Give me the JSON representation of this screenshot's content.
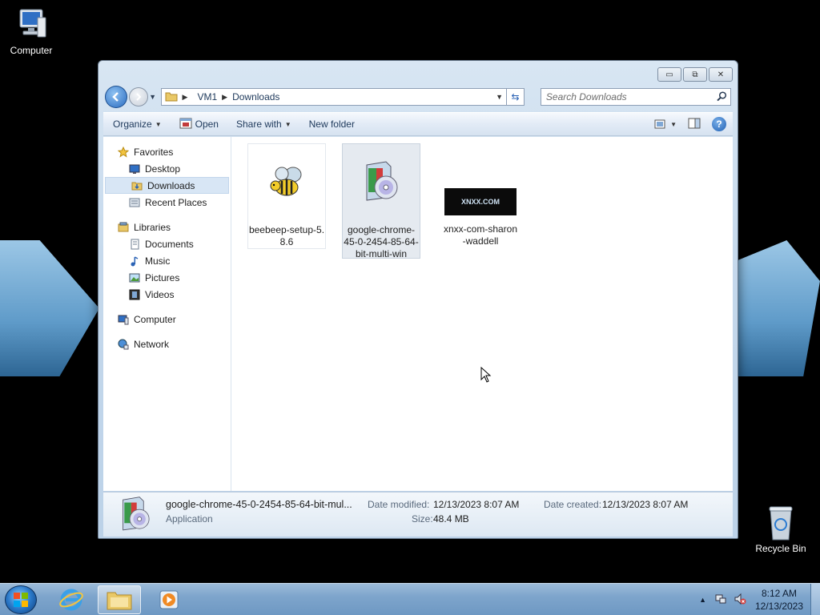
{
  "desktop": {
    "computer_label": "Computer",
    "recycle_bin_label": "Recycle Bin"
  },
  "window": {
    "caption_buttons": {
      "minimize": "▭",
      "maximize": "⧉",
      "close": "✕"
    },
    "address": {
      "segments": [
        "VM1",
        "Downloads"
      ]
    },
    "search": {
      "placeholder": "Search Downloads"
    },
    "toolbar": {
      "organize": "Organize",
      "open": "Open",
      "share_with": "Share with",
      "new_folder": "New folder"
    },
    "nav_pane": {
      "favorites": "Favorites",
      "desktop": "Desktop",
      "downloads": "Downloads",
      "recent_places": "Recent Places",
      "libraries": "Libraries",
      "documents": "Documents",
      "music": "Music",
      "pictures": "Pictures",
      "videos": "Videos",
      "computer": "Computer",
      "network": "Network"
    },
    "files": [
      {
        "name": "beebeep-setup-5.8.6",
        "name_line1": "beebeep-setup-5.",
        "name_line2": "8.6"
      },
      {
        "name": "google-chrome-45-0-2454-85-64-bit-multi-win",
        "name_line1": "google-chrome-",
        "name_line2": "45-0-2454-85-64-",
        "name_line3": "bit-multi-win"
      },
      {
        "name": "xnxx-com-sharon-waddell",
        "name_line1": "xnxx-com-sharon",
        "name_line2": "-waddell",
        "thumb_text": "XNXX.COM"
      }
    ],
    "details": {
      "name": "google-chrome-45-0-2454-85-64-bit-mul...",
      "type": "Application",
      "date_modified_label": "Date modified:",
      "date_modified": "12/13/2023 8:07 AM",
      "size_label": "Size:",
      "size": "48.4 MB",
      "date_created_label": "Date created:",
      "date_created": "12/13/2023 8:07 AM"
    }
  },
  "taskbar": {
    "time": "8:12 AM",
    "date": "12/13/2023"
  },
  "colors": {
    "accent": "#2a6cc0",
    "selection": "#d8e6f5"
  }
}
